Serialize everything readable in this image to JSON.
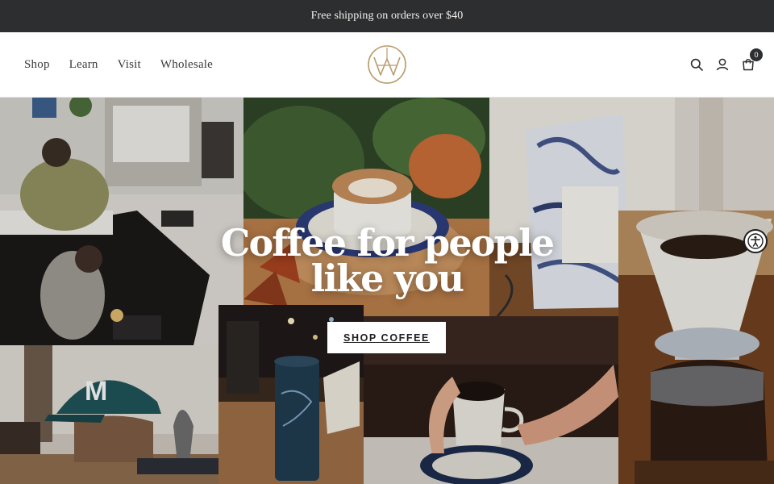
{
  "announcement": {
    "text": "Free shipping on orders over $40"
  },
  "nav": {
    "items": [
      {
        "label": "Shop"
      },
      {
        "label": "Learn"
      },
      {
        "label": "Visit"
      },
      {
        "label": "Wholesale"
      }
    ]
  },
  "header": {
    "logo_icon": "methodical-monogram-logo",
    "cart_count": "0",
    "icons": [
      "search-icon",
      "account-icon",
      "cart-icon"
    ]
  },
  "hero": {
    "title_line1": "Coffee for people",
    "title_line2": "like you",
    "cta_label": "SHOP COFFEE"
  },
  "colors": {
    "announcement_bg": "#2c2e30",
    "logo_gold": "#b99b6b",
    "text": "#3a3a3a",
    "button_bg": "#ffffff"
  },
  "accessibility": {
    "icon": "accessibility-icon"
  }
}
